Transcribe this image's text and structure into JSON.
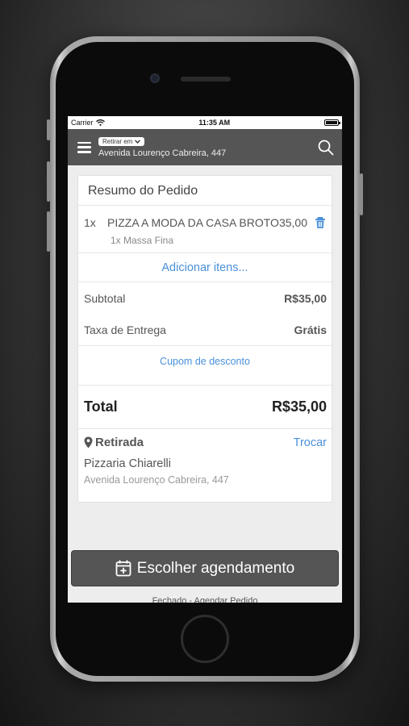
{
  "status_bar": {
    "carrier": "Carrier",
    "time": "11:35 AM"
  },
  "header": {
    "pickup_selector": "Retirar em",
    "address": "Avenida Lourenço Cabreira, 447"
  },
  "order": {
    "title": "Resumo do Pedido",
    "items": [
      {
        "qty": "1x",
        "name": "PIZZA A MODA DA CASA BROTO",
        "price": "35,00",
        "option": "1x Massa Fina"
      }
    ],
    "add_items": "Adicionar itens...",
    "subtotal_label": "Subtotal",
    "subtotal_value": "R$35,00",
    "delivery_label": "Taxa de Entrega",
    "delivery_value": "Grátis",
    "coupon_label": "Cupom de desconto",
    "total_label": "Total",
    "total_value": "R$35,00"
  },
  "pickup": {
    "label": "Retirada",
    "change_label": "Trocar",
    "store_name": "Pizzaria Chiarelli",
    "store_address": "Avenida Lourenço Cabreira, 447"
  },
  "schedule_button": "Escolher agendamento",
  "closed_note": "Fechado - Agendar Pedido",
  "colors": {
    "link": "#4a90d9",
    "header_bg": "#555555",
    "button_bg": "#555555"
  },
  "icons": [
    "wifi-icon",
    "battery-icon",
    "menu-icon",
    "chevron-down-icon",
    "search-icon",
    "trash-icon",
    "map-pin-icon",
    "calendar-plus-icon"
  ]
}
